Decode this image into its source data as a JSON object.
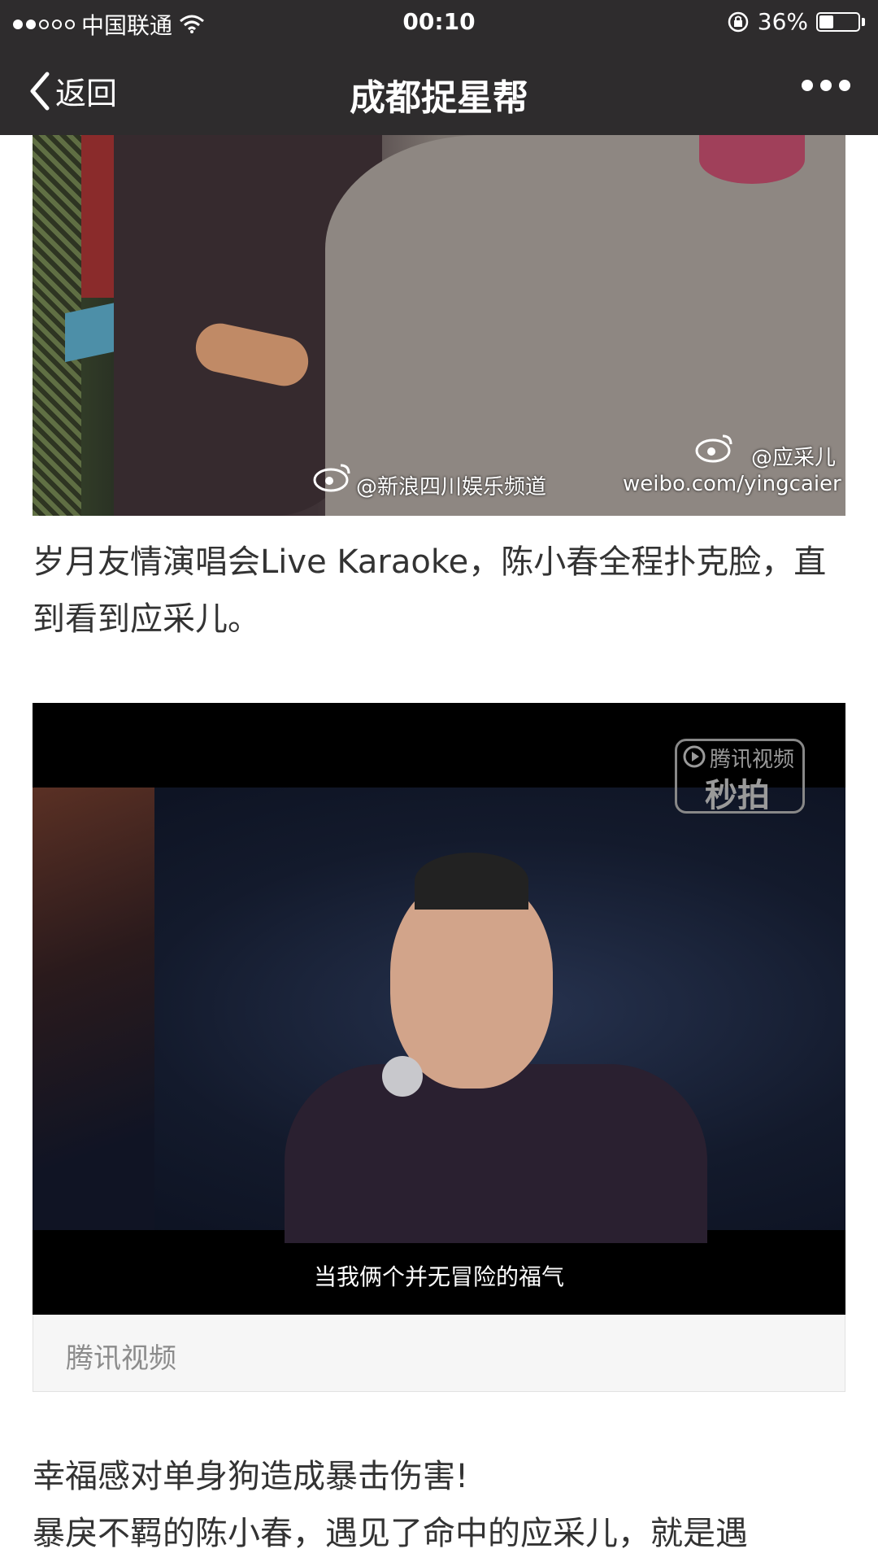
{
  "status_bar": {
    "carrier": "中国联通",
    "time": "00:10",
    "battery_percent": "36%",
    "battery_level": 0.36,
    "signal_dots_filled": 2,
    "signal_dots_total": 5
  },
  "navbar": {
    "back_label": "返回",
    "title": "成都捉星帮"
  },
  "article": {
    "photo_watermark_left": "@新浪四川娱乐频道",
    "photo_watermark_right_user": "@应采儿",
    "photo_watermark_right_url": "weibo.com/yingcaier",
    "caption1": "岁月友情演唱会Live Karaoke，陈小春全程扑克脸，直到看到应采儿。",
    "video": {
      "logo_brand": "腾讯视频",
      "logo_name": "秒拍",
      "subtitle": "当我俩个并无冒险的福气",
      "source": "腾讯视频"
    },
    "paragraph2": [
      "幸福感对单身狗造成暴击伤害!",
      "暴戾不羁的陈小春，遇见了命中的应采儿，就是遇"
    ]
  },
  "colors": {
    "bar_background": "#2e2c2d",
    "text": "#333333",
    "footer_text": "#8c8c8c"
  }
}
